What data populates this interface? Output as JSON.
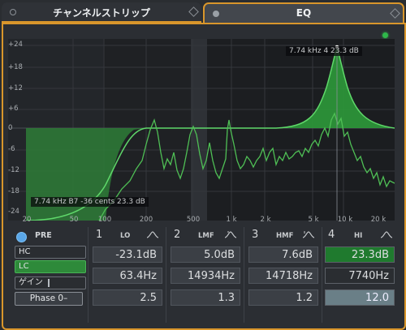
{
  "tabs": [
    {
      "label": "チャンネルストリップ",
      "active": false
    },
    {
      "label": "EQ",
      "active": true
    }
  ],
  "graph": {
    "y_ticks": [
      "+24",
      "+18",
      "+12",
      "+6",
      "0",
      "-6",
      "-12",
      "-18",
      "-24"
    ],
    "x_ticks": [
      "20",
      "50",
      "100",
      "200",
      "500",
      "1 k",
      "2 k",
      "5 k",
      "10 k",
      "20 k"
    ],
    "top_readout": "7.74 kHz    4    23.3 dB",
    "cursor_readout": "7.74 kHz     B7     -36 cents     23.3 dB",
    "colors": {
      "curve": "#3fbf4a",
      "fill": "#2e8f39",
      "background": "#1b1d20"
    }
  },
  "pre": {
    "label": "PRE",
    "hc_label": "HC",
    "lc_label": "LC",
    "gain_label": "ゲイン",
    "phase_label": "Phase 0–"
  },
  "bands": [
    {
      "number": "1",
      "name": "LO",
      "gain": "-23.1dB",
      "freq": "63.4Hz",
      "q": "2.5"
    },
    {
      "number": "2",
      "name": "LMF",
      "gain": "5.0dB",
      "freq": "14934Hz",
      "q": "1.3"
    },
    {
      "number": "3",
      "name": "HMF",
      "gain": "7.6dB",
      "freq": "14718Hz",
      "q": "1.2"
    },
    {
      "number": "4",
      "name": "HI",
      "gain": "23.3dB",
      "freq": "7740Hz",
      "q": "12.0"
    }
  ]
}
